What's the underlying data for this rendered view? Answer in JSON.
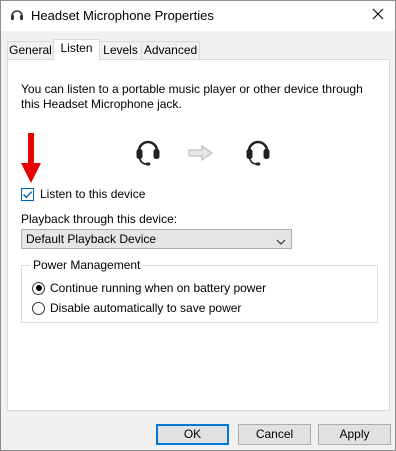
{
  "window": {
    "title": "Headset Microphone Properties"
  },
  "tabs": [
    {
      "label": "General"
    },
    {
      "label": "Listen"
    },
    {
      "label": "Levels"
    },
    {
      "label": "Advanced"
    }
  ],
  "listen": {
    "description": "You can listen to a portable music player or other device through this Headset Microphone jack.",
    "checkbox_label": "Listen to this device",
    "checkbox_checked": true,
    "playback_label": "Playback through this device:",
    "playback_selected": "Default Playback Device"
  },
  "power": {
    "group_title": "Power Management",
    "option1": "Continue running when on battery power",
    "option2": "Disable automatically to save power",
    "selected": "option1"
  },
  "buttons": {
    "ok": "OK",
    "cancel": "Cancel",
    "apply": "Apply"
  },
  "colors": {
    "accent": "#0078d7",
    "annotation_arrow": "#e60000"
  }
}
